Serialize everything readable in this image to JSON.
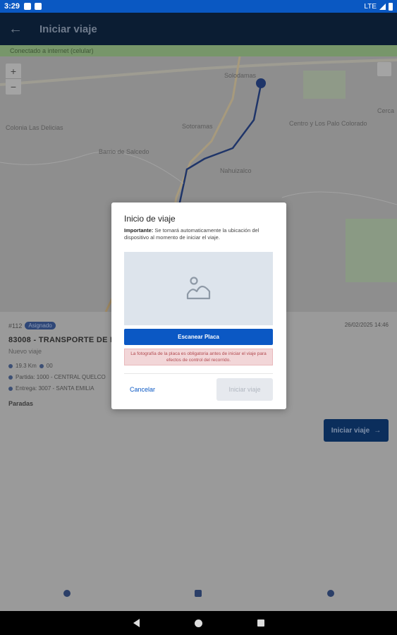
{
  "status_bar": {
    "time": "3:29",
    "network": "LTE"
  },
  "app_bar": {
    "back_icon": "arrow-left-icon",
    "title": "Iniciar viaje"
  },
  "connection": {
    "text": "Conectado a internet (celular)"
  },
  "map": {
    "zoom_in": "+",
    "zoom_out": "−",
    "labels": [
      "Solodamas",
      "Sotoramas",
      "Nahuizalco",
      "Barrio de Salcedo",
      "Colonia Las Delicias",
      "Centro y Los Palo Colorado",
      "Cerca"
    ]
  },
  "trip": {
    "number": "#112",
    "badge": "Asignado",
    "date": "26/02/2025 14:46",
    "company": "83008 - TRANSPORTE DE PE",
    "subtitle": "Nuevo viaje",
    "meta1_a": "19.3 Km",
    "meta1_b": "00",
    "origin": "Partida: 1000 - CENTRAL QUELCO",
    "destination": "Entrega: 3007 - SANTA EMILIA",
    "stops_label": "Paradas",
    "start_label": "Iniciar viaje"
  },
  "dialog": {
    "title": "Inicio de viaje",
    "msg_strong": "Importante:",
    "msg": "Se tomará automaticamente la ubicación del dispositivo al momento de iniciar el viaje.",
    "photo_icon": "image-placeholder-icon",
    "scan_label": "Escanear Placa",
    "warning": "La fotografía de la placa es obligatoria antes de iniciar el viaje para efectos de control del recorrido.",
    "cancel_label": "Cancelar",
    "start_label": "Iniciar viaje"
  },
  "colors": {
    "primary": "#0b58c4",
    "app_bar": "#0b1d33",
    "warning_bg": "#f2d6d8"
  }
}
